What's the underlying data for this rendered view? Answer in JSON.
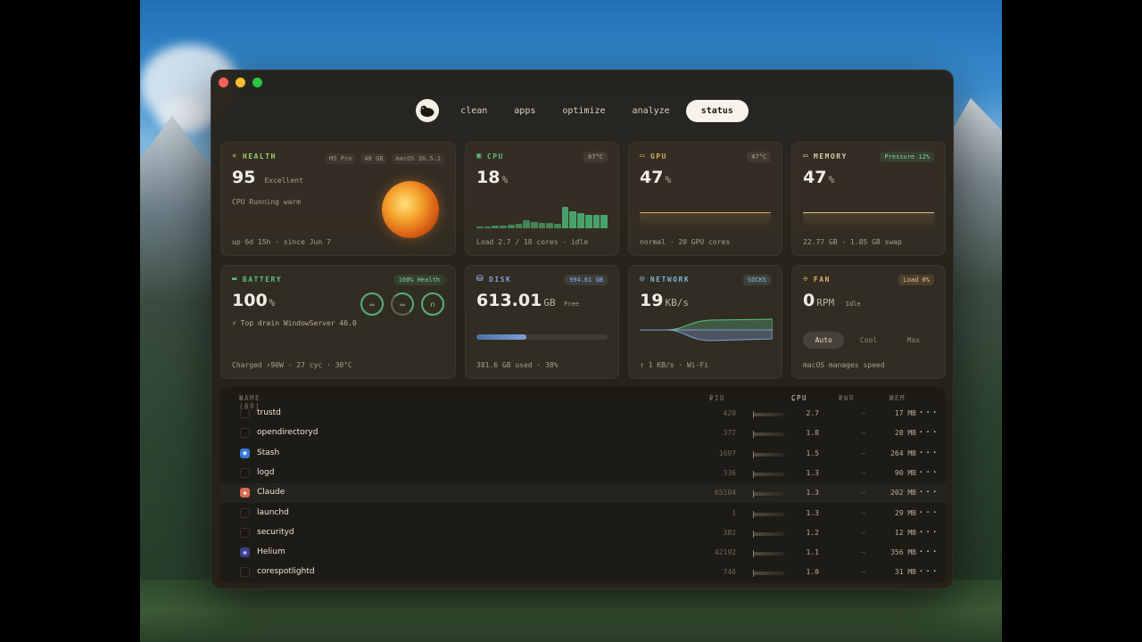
{
  "nav": {
    "tabs": [
      {
        "label": "clean"
      },
      {
        "label": "apps"
      },
      {
        "label": "optimize"
      },
      {
        "label": "analyze"
      },
      {
        "label": "status",
        "active": true
      }
    ]
  },
  "health": {
    "title": "HEALTH",
    "chips": [
      "M5 Pro",
      "48 GB",
      "macOS 26.5.1"
    ],
    "score": "95",
    "rating": "Excellent",
    "status": "CPU Running warm",
    "uptime": "up 6d 15h · since Jun 7"
  },
  "cpu": {
    "title": "CPU",
    "temp": "67°C",
    "value": "18",
    "unit": "%",
    "footer": "Load 2.7 / 18 cores · idle",
    "history": [
      2,
      2,
      3,
      3,
      4,
      5,
      9,
      7,
      6,
      6,
      5,
      23,
      18,
      16,
      14,
      14,
      14
    ]
  },
  "gpu": {
    "title": "GPU",
    "temp": "47°C",
    "value": "47",
    "unit": "%",
    "footer": "normal · 20 GPU cores"
  },
  "memory": {
    "title": "MEMORY",
    "pressure": "Pressure 12%",
    "value": "47",
    "unit": "%",
    "footer": "22.77 GB · 1.85 GB swap"
  },
  "battery": {
    "title": "BATTERY",
    "health": "100% Health",
    "value": "100",
    "unit": "%",
    "drain": "Top drain WindowServer 46.0",
    "footer": "Charged ⚡90W · 27 cyc · 30°C"
  },
  "disk": {
    "title": "DISK",
    "total": "994.61 GB",
    "value": "613.01",
    "unit": "GB",
    "unit_suffix": "Free",
    "used_fraction": 0.38,
    "footer": "381.6 GB used · 38%"
  },
  "network": {
    "title": "NETWORK",
    "proxy": "SOCKS",
    "value": "19",
    "unit": "KB/s",
    "footer": "↑ 1 KB/s · Wi-Fi"
  },
  "fan": {
    "title": "FAN",
    "load": "Load 0%",
    "value": "0",
    "unit": "RPM",
    "state": "Idle",
    "modes": [
      "Auto",
      "Cool",
      "Max"
    ],
    "active_mode": "Auto",
    "footer": "macOS manages speed"
  },
  "table": {
    "headers": {
      "name": "NAME (60)",
      "pid": "PID",
      "cpu": "CPU",
      "pwr": "PWR",
      "mem": "MEM"
    },
    "rows": [
      {
        "name": "trustd",
        "pid": "420",
        "cpu": "2.7",
        "pwr": "—",
        "mem": "17 MB"
      },
      {
        "name": "opendirectoryd",
        "pid": "377",
        "cpu": "1.8",
        "pwr": "—",
        "mem": "28 MB"
      },
      {
        "name": "Stash",
        "pid": "1697",
        "cpu": "1.5",
        "pwr": "—",
        "mem": "264 MB"
      },
      {
        "name": "logd",
        "pid": "336",
        "cpu": "1.3",
        "pwr": "—",
        "mem": "90 MB"
      },
      {
        "name": "Claude",
        "pid": "65104",
        "cpu": "1.3",
        "pwr": "—",
        "mem": "202 MB"
      },
      {
        "name": "launchd",
        "pid": "1",
        "cpu": "1.3",
        "pwr": "—",
        "mem": "29 MB"
      },
      {
        "name": "securityd",
        "pid": "382",
        "cpu": "1.2",
        "pwr": "—",
        "mem": "12 MB"
      },
      {
        "name": "Helium",
        "pid": "42192",
        "cpu": "1.1",
        "pwr": "—",
        "mem": "356 MB"
      },
      {
        "name": "corespotlightd",
        "pid": "746",
        "cpu": "1.0",
        "pwr": "—",
        "mem": "31 MB"
      }
    ]
  },
  "colors": {
    "health": "#9ccf6e",
    "cpu": "#5fbf7e",
    "gpu": "#d8a860",
    "memory": "#d8c8a8",
    "battery": "#5fbf7e",
    "disk": "#7d9fd6",
    "network": "#7db6d6",
    "fan": "#e0b070"
  }
}
